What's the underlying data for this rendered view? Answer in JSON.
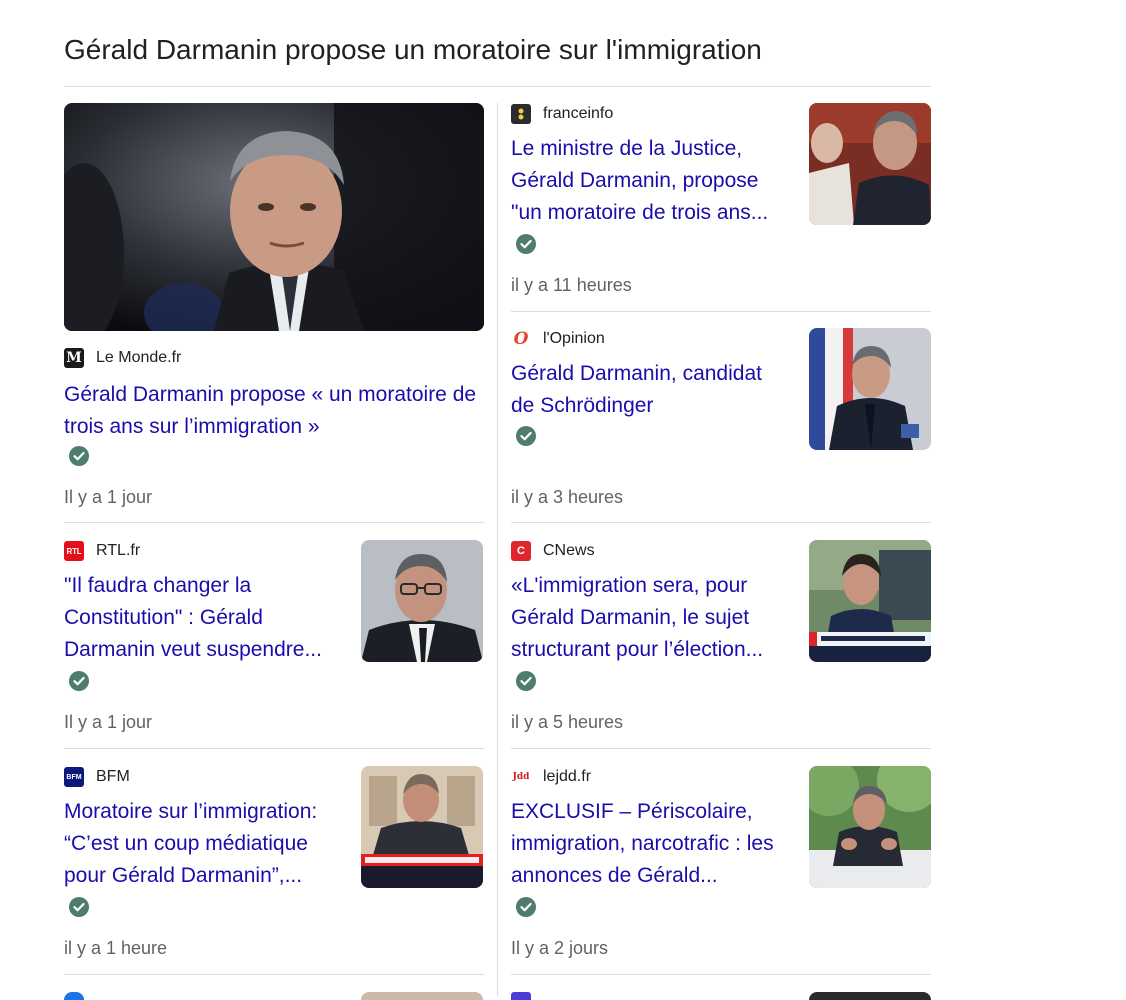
{
  "heading": "Gérald Darmanin propose un moratoire sur l'immigration",
  "articles": [
    {
      "source": "Le Monde.fr",
      "title": "Gérald Darmanin propose « un moratoire de trois ans sur l’immigration »",
      "time": "Il y a 1 jour"
    },
    {
      "source": "franceinfo",
      "title": "Le ministre de la Justice, Gérald Darmanin, propose \"un moratoire de trois ans...",
      "time": "il y a 11 heures"
    },
    {
      "source": "l'Opinion",
      "title": "Gérald Darmanin, candidat de Schrödinger",
      "time": "il y a 3 heures"
    },
    {
      "source": "RTL.fr",
      "title": "\"Il faudra changer la Constitution\" : Gérald Darmanin veut suspendre...",
      "time": "Il y a 1 jour"
    },
    {
      "source": "CNews",
      "title": "«L'immigration sera, pour Gérald Darmanin, le sujet structurant pour l’élection...",
      "time": "il y a 5 heures"
    },
    {
      "source": "BFM",
      "title": "Moratoire sur l’immigration: “C’est un coup médiatique pour Gérald Darmanin”,...",
      "time": "il y a 1 heure"
    },
    {
      "source": "lejdd.fr",
      "title": "EXCLUSIF – Périscolaire, immigration, narcotrafic : les annonces de Gérald...",
      "time": "Il y a 2 jours"
    }
  ],
  "favicons": {
    "le_monde": "M",
    "franceinfo": "•",
    "lopinion": "O",
    "rtl": "RTL",
    "cnews": "C",
    "bfm": "BFM",
    "lejdd": "Jdd"
  },
  "colors": {
    "link": "#1a0dab",
    "muted": "#5f6368",
    "verified": "#4f7d6b",
    "divider": "#dadce0"
  }
}
